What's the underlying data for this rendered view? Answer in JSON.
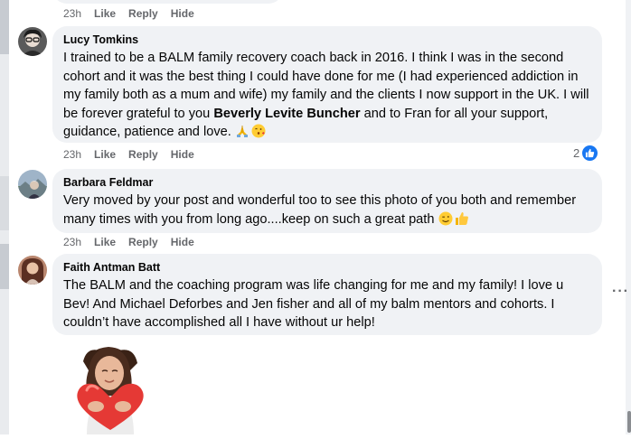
{
  "comments": [
    {
      "actions": {
        "time": "23h",
        "like": "Like",
        "reply": "Reply",
        "hide": "Hide"
      }
    },
    {
      "author": "Lucy Tomkins",
      "text_parts": [
        "I trained to be a BALM family recovery coach back in 2016. I think I was in the second cohort and it was the best thing I could have done for me (I had experienced addiction in my family both as a mum and wife) my family and the clients I now support in the UK. I will be forever grateful to you ",
        "Beverly Levite Buncher",
        " and to Fran for all your support, guidance, patience and love. "
      ],
      "emoji": [
        "folded-hands-emoji",
        "face-blowing-kiss-emoji"
      ],
      "actions": {
        "time": "23h",
        "like": "Like",
        "reply": "Reply",
        "hide": "Hide"
      },
      "reaction_count": "2",
      "reaction_icon": "thumbs-up-icon",
      "reaction_color": "#1877f2"
    },
    {
      "author": "Barbara Feldmar",
      "text": "Very moved by your post and wonderful too to see this photo of you both and remember many times with you from long ago....keep on such a great path ",
      "emoji": [
        "winking-face-emoji",
        "thumbs-up-emoji"
      ],
      "actions": {
        "time": "23h",
        "like": "Like",
        "reply": "Reply",
        "hide": "Hide"
      }
    },
    {
      "author": "Faith Antman Batt",
      "text": "The BALM and the coaching program was life changing for me and my family! I love u Bev! And Michael Deforbes and Jen fisher and all of my balm mentors and cohorts. I couldn’t have accomplished all I have without ur help!",
      "more_icon": "more-options-icon",
      "more_glyph": "···",
      "sticker": "hugging-heart-avatar-sticker"
    }
  ],
  "colors": {
    "bubble": "#f0f2f5",
    "meta_text": "#65676b",
    "accent": "#1877f2"
  }
}
